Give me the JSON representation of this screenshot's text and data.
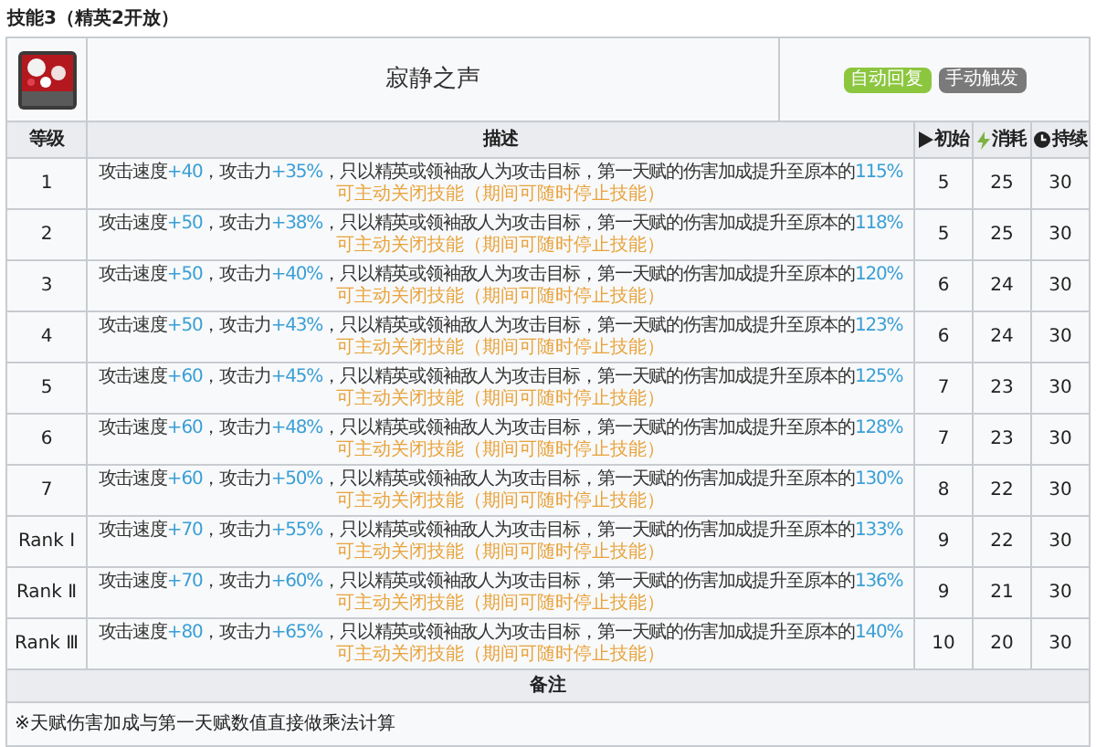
{
  "section_title": "技能3（精英2开放）",
  "skill": {
    "name": "寂静之声",
    "tags": [
      {
        "label": "自动回复",
        "kind": "recovery"
      },
      {
        "label": "手动触发",
        "kind": "trigger"
      }
    ]
  },
  "columns": [
    {
      "label": "等级",
      "kind": "plain"
    },
    {
      "label": "描述",
      "kind": "plain"
    },
    {
      "label": "初始",
      "kind": "play"
    },
    {
      "label": "消耗",
      "kind": "bolt"
    },
    {
      "label": "持续",
      "kind": "clock"
    }
  ],
  "rows": [
    {
      "level": "1",
      "description": [
        {
          "kind": "text",
          "text": "攻击速度"
        },
        {
          "kind": "value",
          "text": "+40"
        },
        {
          "kind": "text",
          "text": "，攻击力"
        },
        {
          "kind": "value",
          "text": "+35%"
        },
        {
          "kind": "text",
          "text": "，只以精英或领袖敌人为攻击目标，第一天赋的伤害加成提升至原本的"
        },
        {
          "kind": "value",
          "text": "115%"
        }
      ],
      "note": "可主动关闭技能（期间可随时停止技能）",
      "initial": "5",
      "cost": "25",
      "duration": "30"
    },
    {
      "level": "2",
      "description": [
        {
          "kind": "text",
          "text": "攻击速度"
        },
        {
          "kind": "value",
          "text": "+50"
        },
        {
          "kind": "text",
          "text": "，攻击力"
        },
        {
          "kind": "value",
          "text": "+38%"
        },
        {
          "kind": "text",
          "text": "，只以精英或领袖敌人为攻击目标，第一天赋的伤害加成提升至原本的"
        },
        {
          "kind": "value",
          "text": "118%"
        }
      ],
      "note": "可主动关闭技能（期间可随时停止技能）",
      "initial": "5",
      "cost": "25",
      "duration": "30"
    },
    {
      "level": "3",
      "description": [
        {
          "kind": "text",
          "text": "攻击速度"
        },
        {
          "kind": "value",
          "text": "+50"
        },
        {
          "kind": "text",
          "text": "，攻击力"
        },
        {
          "kind": "value",
          "text": "+40%"
        },
        {
          "kind": "text",
          "text": "，只以精英或领袖敌人为攻击目标，第一天赋的伤害加成提升至原本的"
        },
        {
          "kind": "value",
          "text": "120%"
        }
      ],
      "note": "可主动关闭技能（期间可随时停止技能）",
      "initial": "6",
      "cost": "24",
      "duration": "30"
    },
    {
      "level": "4",
      "description": [
        {
          "kind": "text",
          "text": "攻击速度"
        },
        {
          "kind": "value",
          "text": "+50"
        },
        {
          "kind": "text",
          "text": "，攻击力"
        },
        {
          "kind": "value",
          "text": "+43%"
        },
        {
          "kind": "text",
          "text": "，只以精英或领袖敌人为攻击目标，第一天赋的伤害加成提升至原本的"
        },
        {
          "kind": "value",
          "text": "123%"
        }
      ],
      "note": "可主动关闭技能（期间可随时停止技能）",
      "initial": "6",
      "cost": "24",
      "duration": "30"
    },
    {
      "level": "5",
      "description": [
        {
          "kind": "text",
          "text": "攻击速度"
        },
        {
          "kind": "value",
          "text": "+60"
        },
        {
          "kind": "text",
          "text": "，攻击力"
        },
        {
          "kind": "value",
          "text": "+45%"
        },
        {
          "kind": "text",
          "text": "，只以精英或领袖敌人为攻击目标，第一天赋的伤害加成提升至原本的"
        },
        {
          "kind": "value",
          "text": "125%"
        }
      ],
      "note": "可主动关闭技能（期间可随时停止技能）",
      "initial": "7",
      "cost": "23",
      "duration": "30"
    },
    {
      "level": "6",
      "description": [
        {
          "kind": "text",
          "text": "攻击速度"
        },
        {
          "kind": "value",
          "text": "+60"
        },
        {
          "kind": "text",
          "text": "，攻击力"
        },
        {
          "kind": "value",
          "text": "+48%"
        },
        {
          "kind": "text",
          "text": "，只以精英或领袖敌人为攻击目标，第一天赋的伤害加成提升至原本的"
        },
        {
          "kind": "value",
          "text": "128%"
        }
      ],
      "note": "可主动关闭技能（期间可随时停止技能）",
      "initial": "7",
      "cost": "23",
      "duration": "30"
    },
    {
      "level": "7",
      "description": [
        {
          "kind": "text",
          "text": "攻击速度"
        },
        {
          "kind": "value",
          "text": "+60"
        },
        {
          "kind": "text",
          "text": "，攻击力"
        },
        {
          "kind": "value",
          "text": "+50%"
        },
        {
          "kind": "text",
          "text": "，只以精英或领袖敌人为攻击目标，第一天赋的伤害加成提升至原本的"
        },
        {
          "kind": "value",
          "text": "130%"
        }
      ],
      "note": "可主动关闭技能（期间可随时停止技能）",
      "initial": "8",
      "cost": "22",
      "duration": "30"
    },
    {
      "level": "Rank Ⅰ",
      "description": [
        {
          "kind": "text",
          "text": "攻击速度"
        },
        {
          "kind": "value",
          "text": "+70"
        },
        {
          "kind": "text",
          "text": "，攻击力"
        },
        {
          "kind": "value",
          "text": "+55%"
        },
        {
          "kind": "text",
          "text": "，只以精英或领袖敌人为攻击目标，第一天赋的伤害加成提升至原本的"
        },
        {
          "kind": "value",
          "text": "133%"
        }
      ],
      "note": "可主动关闭技能（期间可随时停止技能）",
      "initial": "9",
      "cost": "22",
      "duration": "30"
    },
    {
      "level": "Rank Ⅱ",
      "description": [
        {
          "kind": "text",
          "text": "攻击速度"
        },
        {
          "kind": "value",
          "text": "+70"
        },
        {
          "kind": "text",
          "text": "，攻击力"
        },
        {
          "kind": "value",
          "text": "+60%"
        },
        {
          "kind": "text",
          "text": "，只以精英或领袖敌人为攻击目标，第一天赋的伤害加成提升至原本的"
        },
        {
          "kind": "value",
          "text": "136%"
        }
      ],
      "note": "可主动关闭技能（期间可随时停止技能）",
      "initial": "9",
      "cost": "21",
      "duration": "30"
    },
    {
      "level": "Rank Ⅲ",
      "description": [
        {
          "kind": "text",
          "text": "攻击速度"
        },
        {
          "kind": "value",
          "text": "+80"
        },
        {
          "kind": "text",
          "text": "，攻击力"
        },
        {
          "kind": "value",
          "text": "+65%"
        },
        {
          "kind": "text",
          "text": "，只以精英或领袖敌人为攻击目标，第一天赋的伤害加成提升至原本的"
        },
        {
          "kind": "value",
          "text": "140%"
        }
      ],
      "note": "可主动关闭技能（期间可随时停止技能）",
      "initial": "10",
      "cost": "20",
      "duration": "30"
    }
  ],
  "remarks": {
    "heading": "备注",
    "text": "※天赋伤害加成与第一天赋数值直接做乘法计算"
  }
}
